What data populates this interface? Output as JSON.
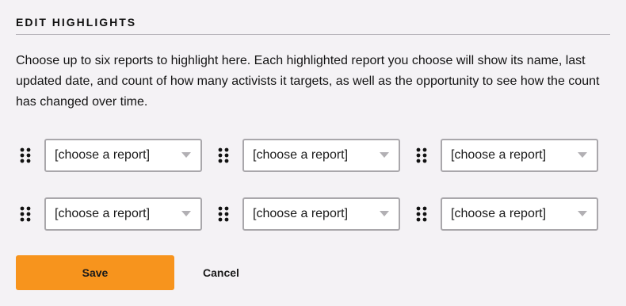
{
  "panel": {
    "title": "EDIT HIGHLIGHTS",
    "description": "Choose up to six reports to highlight here. Each highlighted report you choose will show its name, last updated date, and count of how many activists it targets, as well as the opportunity to see how the count has changed over time."
  },
  "slots": [
    {
      "value": "[choose a report]"
    },
    {
      "value": "[choose a report]"
    },
    {
      "value": "[choose a report]"
    },
    {
      "value": "[choose a report]"
    },
    {
      "value": "[choose a report]"
    },
    {
      "value": "[choose a report]"
    }
  ],
  "actions": {
    "save_label": "Save",
    "cancel_label": "Cancel"
  },
  "colors": {
    "accent": "#f7941d",
    "background": "#f4f2f5",
    "border": "#a9a7ab",
    "caret": "#b2b0b4"
  },
  "icons": {
    "handle": "drag-handle-icon",
    "caret": "chevron-down-icon"
  }
}
